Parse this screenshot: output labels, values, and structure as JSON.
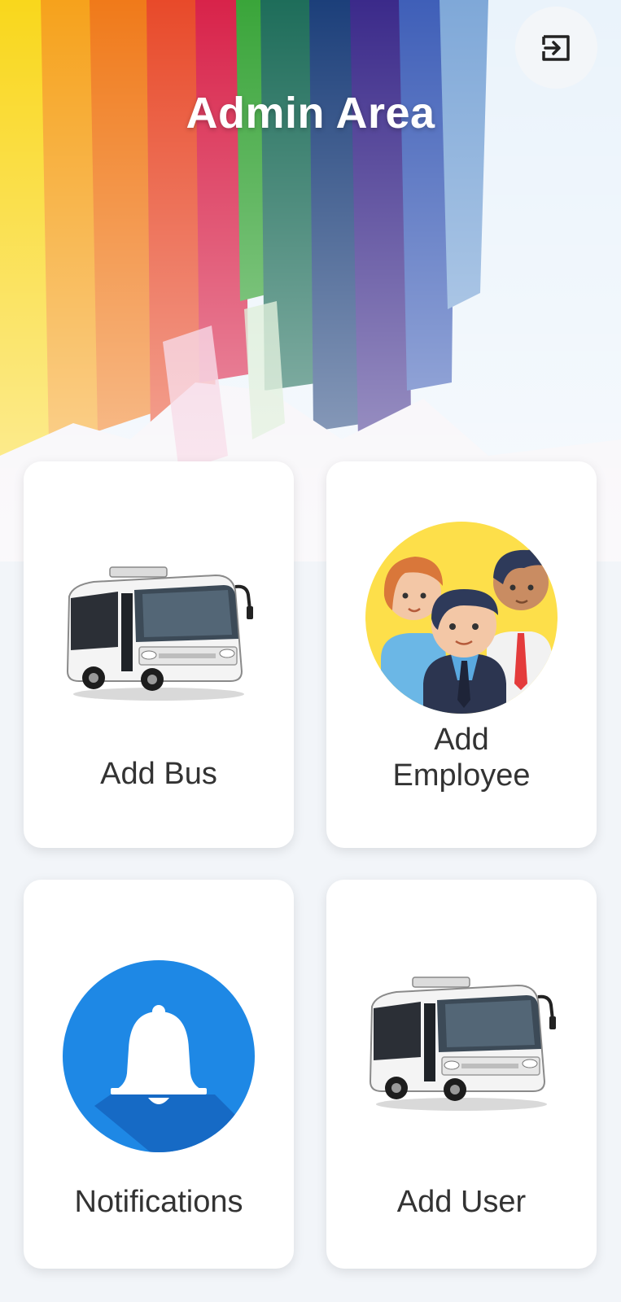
{
  "header": {
    "title": "Admin Area",
    "logout_icon": "logout-icon",
    "background": "rainbow-paint-strokes"
  },
  "menu": [
    {
      "id": "add-bus",
      "label": "Add Bus",
      "icon": "bus-icon"
    },
    {
      "id": "add-employee",
      "label": "Add\nEmployee",
      "icon": "employees-icon"
    },
    {
      "id": "notifications",
      "label": "Notifications",
      "icon": "bell-icon"
    },
    {
      "id": "add-user",
      "label": "Add User",
      "icon": "bus-icon"
    }
  ],
  "colors": {
    "page_background": "#f2f5f9",
    "card_background": "#ffffff",
    "label_text": "#333333",
    "bell_circle": "#1e88e5"
  }
}
